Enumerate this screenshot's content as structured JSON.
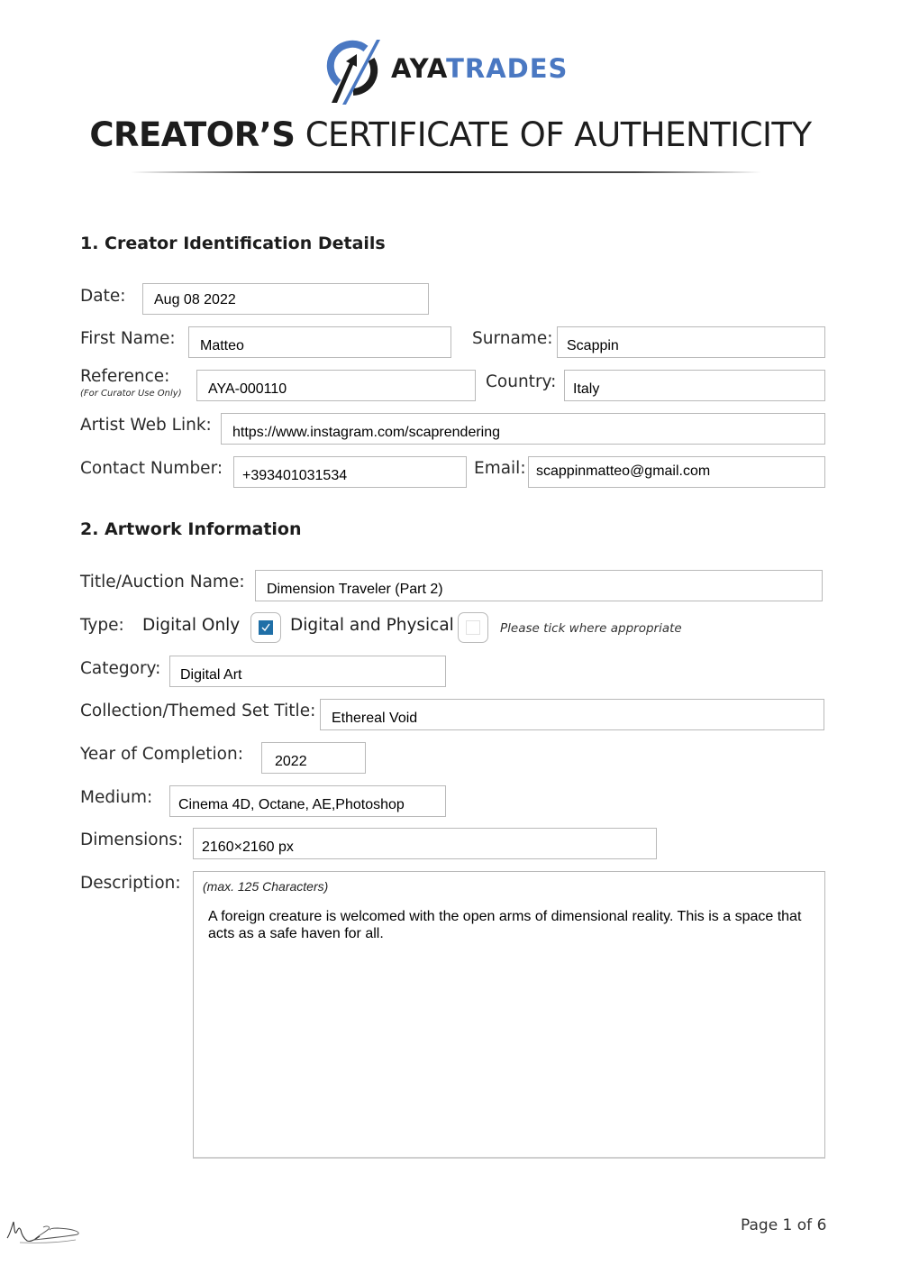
{
  "brand": {
    "name_part1": "AYA",
    "name_part2": "TRADES",
    "accent_color": "#4a78c2",
    "logo_icon": "aya-trades-logo-icon"
  },
  "title": {
    "bold": "CREATOR’S",
    "light": "CERTIFICATE OF AUTHENTICITY"
  },
  "section1": {
    "heading": "1. Creator Identification Details",
    "date": {
      "label": "Date:",
      "value": "Aug 08 2022"
    },
    "first_name": {
      "label": "First Name:",
      "value": "Matteo"
    },
    "surname": {
      "label": "Surname:",
      "value": "Scappin"
    },
    "reference": {
      "label": "Reference:",
      "sublabel": "(For Curator Use Only)",
      "value": "AYA-000110"
    },
    "country": {
      "label": "Country:",
      "value": "Italy"
    },
    "web_link": {
      "label": "Artist Web Link:",
      "value": "https://www.instagram.com/scaprendering"
    },
    "contact": {
      "label": "Contact Number:",
      "value": "+393401031534"
    },
    "email": {
      "label": "Email:",
      "value": "scappinmatteo@gmail.com"
    }
  },
  "section2": {
    "heading": "2. Artwork Information",
    "title": {
      "label": "Title/Auction Name:",
      "value": "Dimension Traveler (Part 2)"
    },
    "type": {
      "label": "Type:",
      "options": [
        {
          "label": "Digital Only",
          "checked": true
        },
        {
          "label": "Digital and Physical",
          "checked": false
        }
      ],
      "hint": "Please tick where appropriate",
      "check_color": "#1f6fa7"
    },
    "category": {
      "label": "Category:",
      "value": "Digital Art"
    },
    "collection": {
      "label": "Collection/Themed Set Title:",
      "value": "Ethereal Void"
    },
    "year": {
      "label": "Year of Completion:",
      "value": "2022"
    },
    "medium": {
      "label": "Medium:",
      "value": "Cinema 4D, Octane, AE,Photoshop"
    },
    "dimensions": {
      "label": "Dimensions:",
      "value": "2160×2160 px"
    },
    "description": {
      "label": "Description:",
      "hint": "(max. 125 Characters)",
      "value": "A foreign creature is welcomed with the open arms of dimensional reality. This is a space that acts as a safe haven for all."
    }
  },
  "footer": {
    "signature_icon": "signature-icon",
    "page_label": "Page 1 of 6"
  }
}
